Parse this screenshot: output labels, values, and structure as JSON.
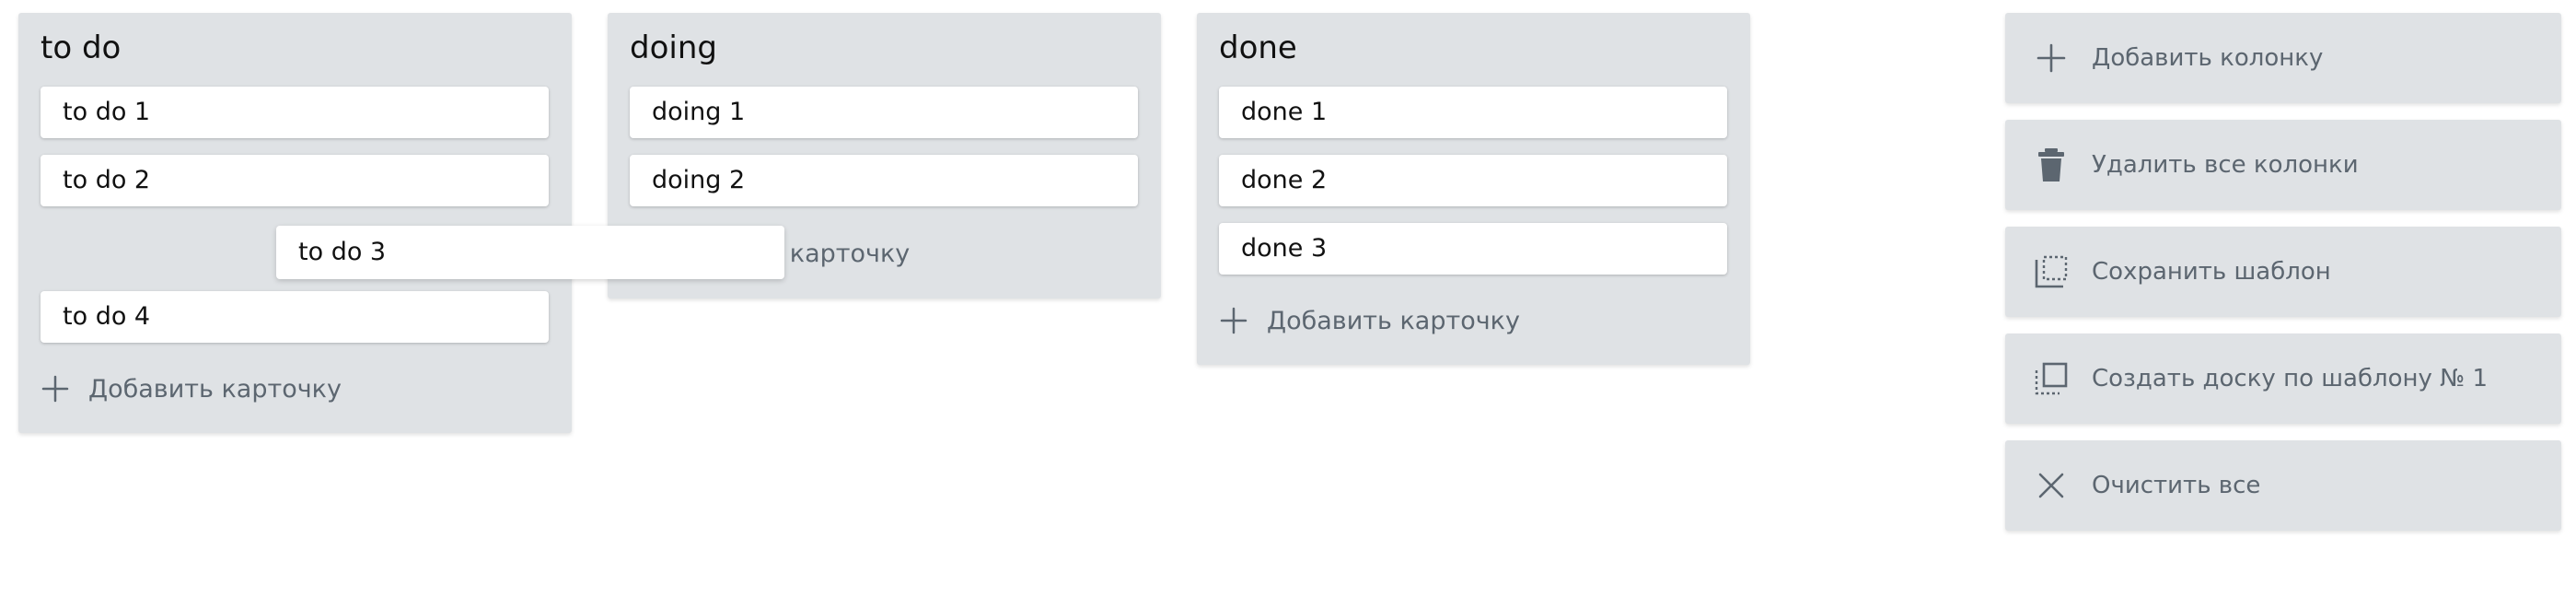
{
  "columns": [
    {
      "title": "to do",
      "cards": [
        "to do 1",
        "to do 2",
        "to do 4"
      ],
      "add_label": "Добавить карточку"
    },
    {
      "title": "doing",
      "cards": [
        "doing 1",
        "doing 2"
      ],
      "add_label": "ить карточку"
    },
    {
      "title": "done",
      "cards": [
        "done 1",
        "done 2",
        "done 3"
      ],
      "add_label": "Добавить карточку"
    }
  ],
  "dragging_card": "to do 3",
  "actions": [
    {
      "label": "Добавить колонку",
      "icon": "plus-icon"
    },
    {
      "label": "Удалить все колонки",
      "icon": "trash-icon"
    },
    {
      "label": "Сохранить шаблон",
      "icon": "save-template-icon"
    },
    {
      "label": "Создать доску по шаблону № 1",
      "icon": "copy-template-icon"
    },
    {
      "label": "Очистить все",
      "icon": "close-icon"
    }
  ],
  "colors": {
    "column_bg": "#dfe2e5",
    "card_bg": "#ffffff",
    "muted_text": "#5c6670",
    "icon": "#5c6670"
  }
}
